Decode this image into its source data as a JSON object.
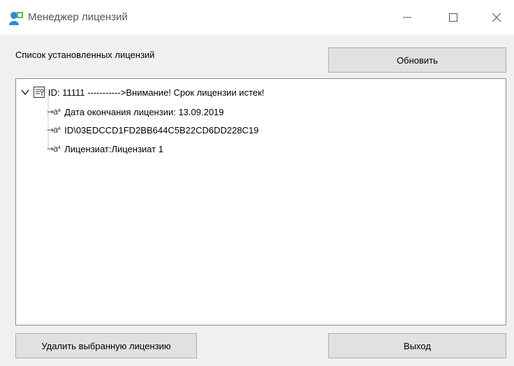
{
  "window": {
    "title": "Менеджер лицензий",
    "icons": {
      "app": "user-key-icon",
      "minimize": "minimize-icon",
      "maximize": "maximize-icon",
      "close": "close-icon"
    }
  },
  "main": {
    "list_label": "Список установленных лицензий",
    "refresh_button": "Обновить",
    "delete_button": "Удалить выбранную лицензию",
    "exit_button": "Выход"
  },
  "tree": {
    "root": {
      "label": "ID: 11111 ----------->Внимание! Срок лицензии истек!",
      "icon": "license-document-icon",
      "expanded": true
    },
    "children": [
      {
        "label": "Дата окончания лицензии: 13.09.2019",
        "icon": "string-value-icon"
      },
      {
        "label": "ID\\03EDCCD1FD2BB644C5B22CD6DD228C19",
        "icon": "string-value-icon"
      },
      {
        "label": "Лицензиат:Лицензиат 1",
        "icon": "string-value-icon"
      }
    ]
  },
  "colors": {
    "accent": "#1e7fcf",
    "window_bg": "#f0f0f0",
    "button_bg": "#e1e1e1"
  }
}
